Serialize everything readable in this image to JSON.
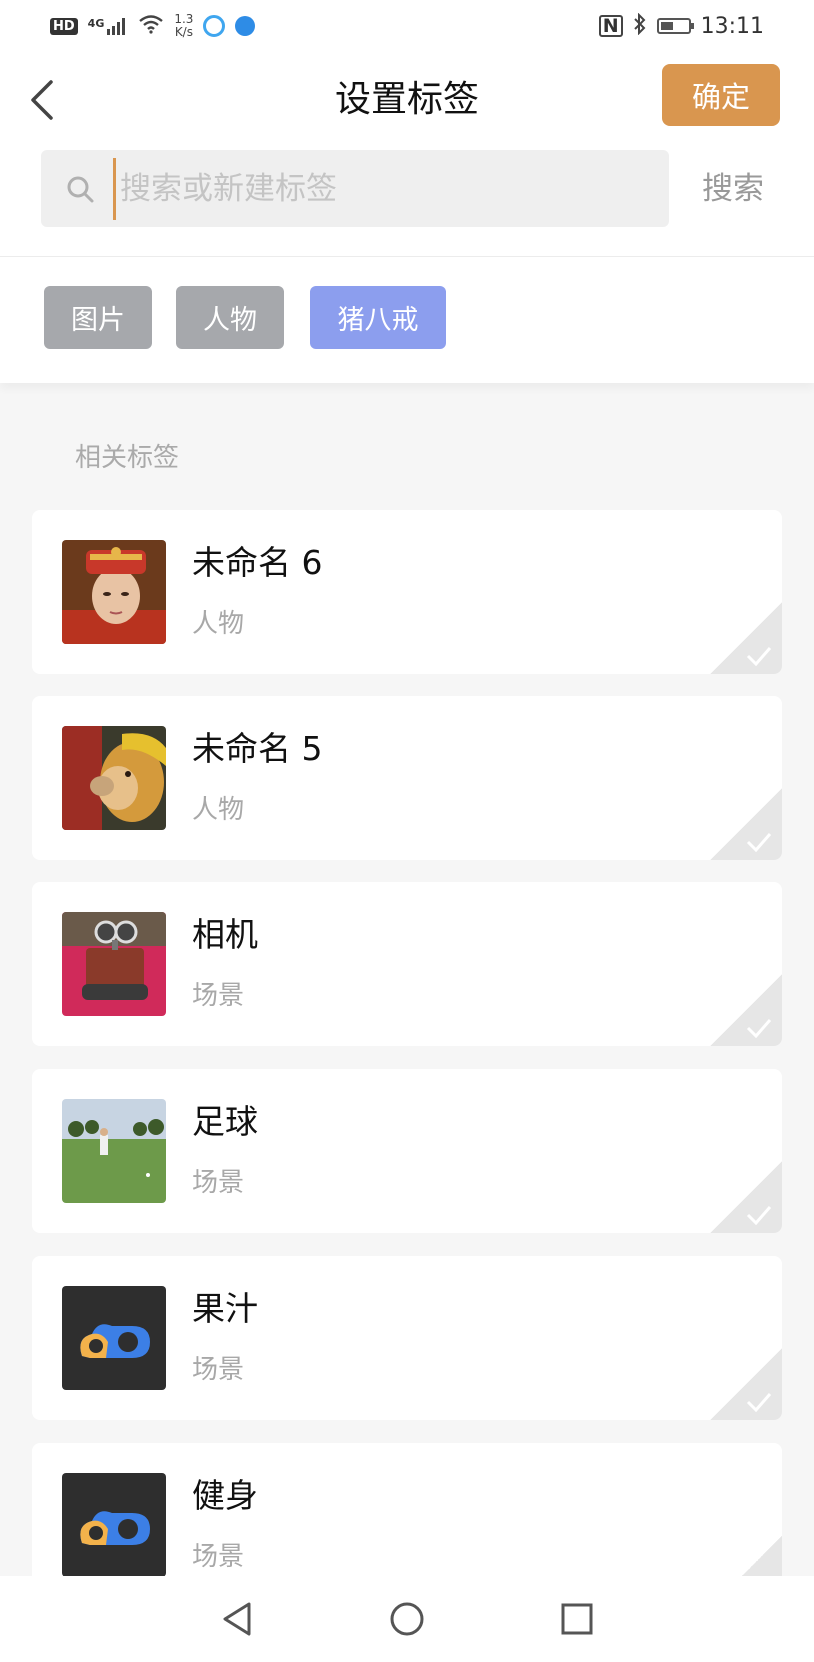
{
  "status_bar": {
    "hd": "HD",
    "network": "4G",
    "speed_top": "1.3",
    "speed_bottom": "K/s",
    "nfc": "N",
    "time": "13:11"
  },
  "header": {
    "title": "设置标签",
    "confirm_label": "确定"
  },
  "search": {
    "placeholder": "搜索或新建标签",
    "value": "",
    "button_label": "搜索"
  },
  "selected_tags": [
    {
      "label": "图片",
      "color": "#a6a8ac"
    },
    {
      "label": "人物",
      "color": "#a6a8ac"
    },
    {
      "label": "猪八戒",
      "color": "#8c9eee"
    }
  ],
  "related": {
    "label": "相关标签",
    "items": [
      {
        "title": "未命名 6",
        "category": "人物",
        "thumb": "photo-person-headdress"
      },
      {
        "title": "未命名 5",
        "category": "人物",
        "thumb": "photo-monkey-king"
      },
      {
        "title": "相机",
        "category": "场景",
        "thumb": "photo-toy-robot"
      },
      {
        "title": "足球",
        "category": "场景",
        "thumb": "photo-golf-field"
      },
      {
        "title": "果汁",
        "category": "场景",
        "thumb": "app-cloud-logo"
      },
      {
        "title": "健身",
        "category": "场景",
        "thumb": "app-cloud-logo"
      }
    ]
  },
  "colors": {
    "accent": "#d9964f",
    "chip_gray": "#a6a8ac",
    "chip_selected": "#8c9eee"
  }
}
